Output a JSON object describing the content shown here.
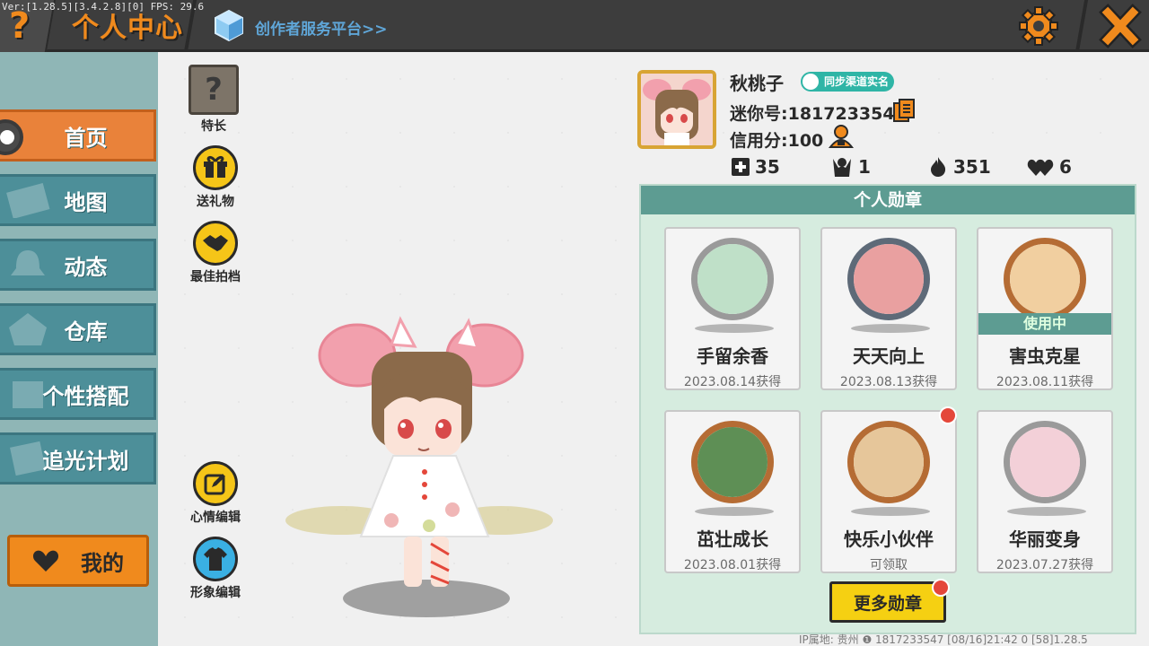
{
  "debug_text": "Ver:[1.28.5][3.4.2.8][0] FPS: 29.6",
  "header": {
    "title": "个人中心",
    "creator_link": "创作者服务平台>>"
  },
  "sidebar": {
    "items": [
      {
        "label": "首页",
        "active": true
      },
      {
        "label": "地图",
        "active": false
      },
      {
        "label": "动态",
        "active": false
      },
      {
        "label": "仓库",
        "active": false
      },
      {
        "label": "个性搭配",
        "active": false
      },
      {
        "label": "追光计划",
        "active": false
      }
    ],
    "mine_label": "我的"
  },
  "actions": {
    "specialty": "特长",
    "gift": "送礼物",
    "best_photo": "最佳拍档",
    "mood_edit": "心情编辑",
    "appearance_edit": "形象编辑"
  },
  "profile": {
    "nickname": "秋桃子",
    "verify_badge": "同步渠道实名",
    "mini_id": "迷你号:1817233547",
    "credit": "信用分:100"
  },
  "stats": {
    "plus": "35",
    "friends": "1",
    "hot": "351",
    "likes": "6"
  },
  "medals": {
    "header": "个人勋章",
    "in_use_label": "使用中",
    "items": [
      {
        "name": "手留余香",
        "date": "2023.08.14获得"
      },
      {
        "name": "天天向上",
        "date": "2023.08.13获得"
      },
      {
        "name": "害虫克星",
        "date": "2023.08.11获得"
      },
      {
        "name": "茁壮成长",
        "date": "2023.08.01获得"
      },
      {
        "name": "快乐小伙伴",
        "date": "可领取"
      },
      {
        "name": "华丽变身",
        "date": "2023.07.27获得"
      }
    ],
    "more_button": "更多勋章"
  },
  "footer": "IP属地: 贵州 ❶    1817233547    [08/16]21:42 0   [58]1.28.5",
  "colors": {
    "accent_orange": "#f08a1d",
    "sidebar_teal": "#4d8f99",
    "panel_teal": "#5d9c92",
    "button_yellow": "#f5d012"
  }
}
